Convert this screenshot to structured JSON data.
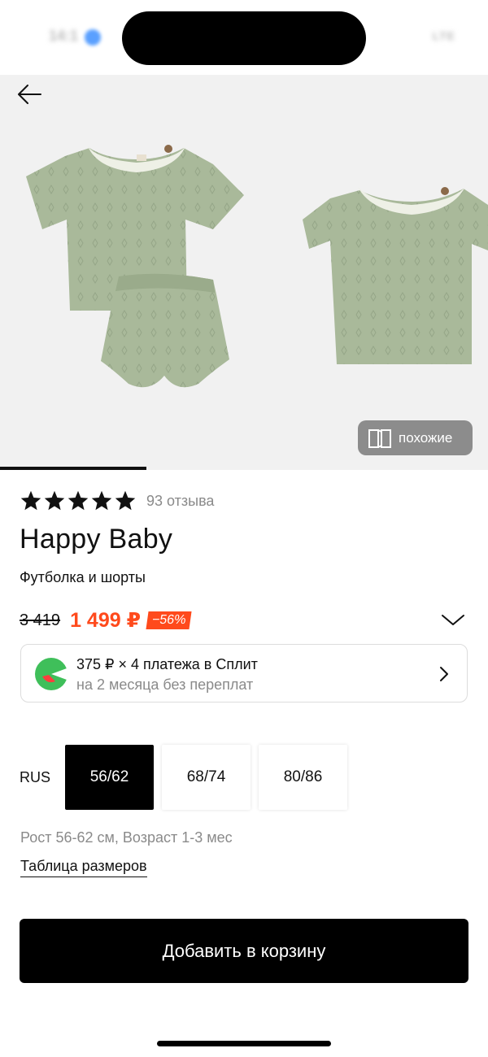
{
  "status_bar": {
    "time": "14:1",
    "right": "LTE"
  },
  "gallery": {
    "similar_label": "похожие",
    "progress": 0.3
  },
  "product": {
    "rating": 5,
    "reviews_label": "93 отзыва",
    "brand": "Happy Baby",
    "name": "Футболка и шорты",
    "old_price": "3 419",
    "new_price": "1 499 ₽",
    "discount": "−56%"
  },
  "split": {
    "title": "375 ₽ × 4 платежа в Сплит",
    "subtitle": "на 2 месяца без переплат"
  },
  "sizes": {
    "system": "RUS",
    "options": [
      "56/62",
      "68/74",
      "80/86"
    ],
    "selected": "56/62",
    "note": "Рост 56-62 см, Возраст 1-3 мес",
    "table_link": "Таблица размеров"
  },
  "cart": {
    "button_label": "Добавить в корзину"
  },
  "colors": {
    "accent": "#ff4a1c",
    "garment": "#a9b99a",
    "split_green": "#3fbf5a"
  }
}
